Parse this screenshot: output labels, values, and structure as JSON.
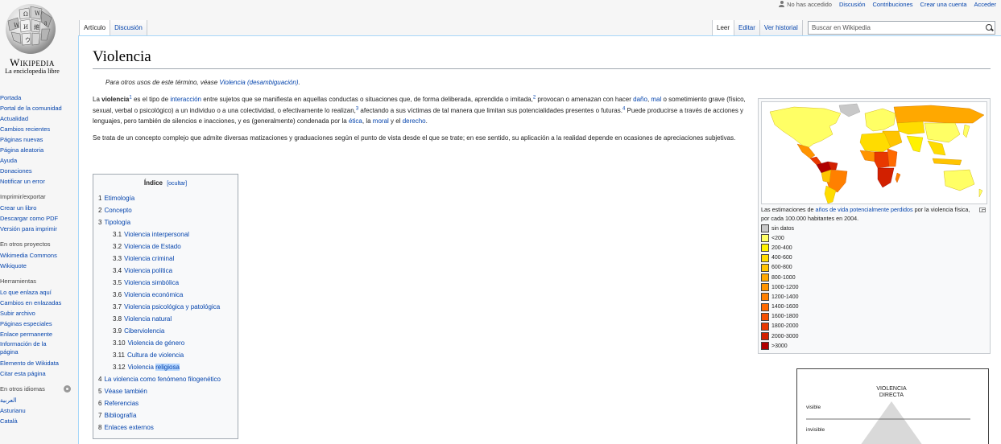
{
  "personal": {
    "not_logged": "No has accedido",
    "links": [
      "Discusión",
      "Contribuciones",
      "Crear una cuenta",
      "Acceder"
    ]
  },
  "logo": {
    "wordmark": "Wikipedia",
    "tagline": "La enciclopedia libre"
  },
  "sidebar": {
    "nav": [
      "Portada",
      "Portal de la comunidad",
      "Actualidad",
      "Cambios recientes",
      "Páginas nuevas",
      "Página aleatoria",
      "Ayuda",
      "Donaciones",
      "Notificar un error"
    ],
    "print_head": "Imprimir/exportar",
    "print": [
      "Crear un libro",
      "Descargar como PDF",
      "Versión para imprimir"
    ],
    "projects_head": "En otros proyectos",
    "projects": [
      "Wikimedia Commons",
      "Wikiquote"
    ],
    "tools_head": "Herramientas",
    "tools": [
      "Lo que enlaza aquí",
      "Cambios en enlazadas",
      "Subir archivo",
      "Páginas especiales",
      "Enlace permanente",
      "Información de la página",
      "Elemento de Wikidata",
      "Citar esta página"
    ],
    "lang_head": "En otros idiomas",
    "langs": [
      "العربية",
      "Asturianu",
      "Català"
    ]
  },
  "tabs": {
    "left": [
      "Artículo",
      "Discusión"
    ],
    "right": [
      "Leer",
      "Editar",
      "Ver historial"
    ]
  },
  "search": {
    "placeholder": "Buscar en Wikipedia"
  },
  "article": {
    "title": "Violencia",
    "hatnote_prefix": "Para otros usos de este término, véase ",
    "hatnote_link": "Violencia (desambiguación)",
    "p1": {
      "t1": "La ",
      "bold": "violencia",
      "s1": "1",
      "t2": " es el tipo de ",
      "l1": "interacción",
      "t3": " entre sujetos que se manifiesta en aquellas conductas o situaciones que, de forma deliberada, aprendida o imitada,",
      "s2": "2",
      "t4": " provocan o amenazan con hacer ",
      "l2": "daño",
      "t5": ", ",
      "l3": "mal",
      "t6": " o sometimiento grave (físico, sexual, verbal o psicológico) a un individuo o a una colectividad, o efectivamente lo realizan,",
      "s3": "3",
      "t7": " afectando a sus víctimas de tal manera que limitan sus potencialidades presentes o futuras.",
      "s4": "4",
      "t8": " Puede producirse a través de acciones y lenguajes, pero también de silencios e inacciones, y es (generalmente) condenada por la ",
      "l4": "ética",
      "t9": ", la ",
      "l5": "moral",
      "t10": " y el ",
      "l6": "derecho",
      "t11": "."
    },
    "p2": "Se trata de un concepto complejo que admite diversas matizaciones y graduaciones según el punto de vista desde el que se trate; en ese sentido, su aplicación a la realidad depende en ocasiones de apreciaciones subjetivas."
  },
  "toc": {
    "title": "Índice",
    "toggle": "[ocultar]",
    "items": [
      {
        "num": "1",
        "label": "Etimología",
        "level": 1
      },
      {
        "num": "2",
        "label": "Concepto",
        "level": 1
      },
      {
        "num": "3",
        "label": "Tipología",
        "level": 1
      },
      {
        "num": "3.1",
        "label": "Violencia interpersonal",
        "level": 2
      },
      {
        "num": "3.2",
        "label": "Violencia de Estado",
        "level": 2
      },
      {
        "num": "3.3",
        "label": "Violencia criminal",
        "level": 2
      },
      {
        "num": "3.4",
        "label": "Violencia política",
        "level": 2
      },
      {
        "num": "3.5",
        "label": "Violencia simbólica",
        "level": 2
      },
      {
        "num": "3.6",
        "label": "Violencia económica",
        "level": 2
      },
      {
        "num": "3.7",
        "label": "Violencia psicológica y patológica",
        "level": 2
      },
      {
        "num": "3.8",
        "label": "Violencia natural",
        "level": 2
      },
      {
        "num": "3.9",
        "label": "Ciberviolencia",
        "level": 2
      },
      {
        "num": "3.10",
        "label": "Violencia de género",
        "level": 2
      },
      {
        "num": "3.11",
        "label": "Cultura de violencia",
        "level": 2
      },
      {
        "num": "3.12",
        "label": "Violencia religiosa",
        "level": 2,
        "highlight": "religiosa"
      },
      {
        "num": "4",
        "label": "La violencia como fenómeno filogenético",
        "level": 1
      },
      {
        "num": "5",
        "label": "Véase también",
        "level": 1
      },
      {
        "num": "6",
        "label": "Referencias",
        "level": 1
      },
      {
        "num": "7",
        "label": "Bibliografía",
        "level": 1
      },
      {
        "num": "8",
        "label": "Enlaces externos",
        "level": 1
      }
    ]
  },
  "thumb": {
    "caption_pre": "Las estimaciones de ",
    "caption_link": "años de vida potencialmente perdidos",
    "caption_post": " por la violencia física, por cada 100.000 habitantes en 2004.",
    "legend": [
      {
        "label": "sin datos",
        "color": "#c8c8c8"
      },
      {
        "label": "<200",
        "color": "#ffff65"
      },
      {
        "label": "200-400",
        "color": "#fff200"
      },
      {
        "label": "400-600",
        "color": "#ffdc00"
      },
      {
        "label": "600-800",
        "color": "#ffc400"
      },
      {
        "label": "800-1000",
        "color": "#ffa800"
      },
      {
        "label": "1000-1200",
        "color": "#ff9400"
      },
      {
        "label": "1200-1400",
        "color": "#ff8000"
      },
      {
        "label": "1400-1600",
        "color": "#ff6a00"
      },
      {
        "label": "1600-1800",
        "color": "#f55000"
      },
      {
        "label": "1800-2000",
        "color": "#e83800"
      },
      {
        "label": "2000-3000",
        "color": "#d22000"
      },
      {
        "label": ">3000",
        "color": "#b00000"
      }
    ]
  },
  "diagram": {
    "title": "VIOLENCIA DIRECTA",
    "visible": "visible",
    "invisible": "invisible"
  }
}
